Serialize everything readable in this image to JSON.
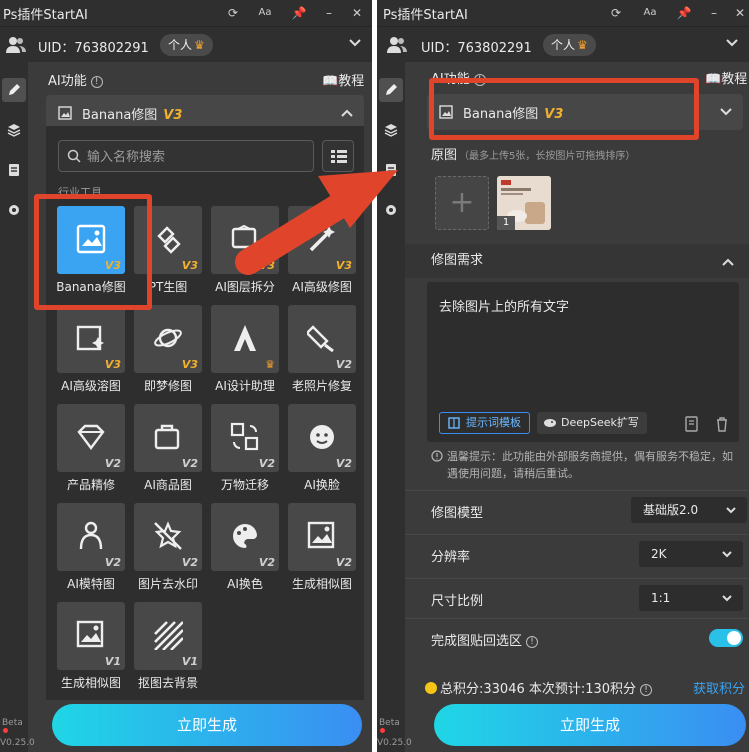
{
  "app_title": "Ps插件StartAI",
  "uid_label": "UID：763802291",
  "plan_badge": "个人",
  "sidebar_beta": "Beta",
  "sidebar_version": "V0.25.0",
  "ai_function_label": "AI功能",
  "tutorial_label": "教程",
  "feature": {
    "name": "Banana修图",
    "version": "V3"
  },
  "left": {
    "search_placeholder": "输入名称搜索",
    "category_label": "行业工具",
    "tools": [
      {
        "label": "Banana修图",
        "ver": "V3",
        "icon": "image-edit-icon"
      },
      {
        "label": "PT生图",
        "ver": "V3",
        "icon": "link-icon"
      },
      {
        "label": "AI图层拆分",
        "ver": "V3",
        "icon": "layer-split-icon"
      },
      {
        "label": "AI高级修图",
        "ver": "V3",
        "icon": "magic-wand-icon"
      },
      {
        "label": "AI高级溶图",
        "ver": "V3",
        "icon": "sparkle-image-icon"
      },
      {
        "label": "即梦修图",
        "ver": "V3",
        "icon": "planet-icon"
      },
      {
        "label": "AI设计助理",
        "ver": "crown",
        "icon": "designer-a-icon"
      },
      {
        "label": "老照片修复",
        "ver": "V2",
        "icon": "restore-icon"
      },
      {
        "label": "产品精修",
        "ver": "V2",
        "icon": "diamond-icon"
      },
      {
        "label": "AI商品图",
        "ver": "V2",
        "icon": "bag-icon"
      },
      {
        "label": "万物迁移",
        "ver": "V2",
        "icon": "transfer-icon"
      },
      {
        "label": "AI换脸",
        "ver": "V2",
        "icon": "face-icon"
      },
      {
        "label": "AI模特图",
        "ver": "V2",
        "icon": "model-icon"
      },
      {
        "label": "图片去水印",
        "ver": "V2",
        "icon": "no-watermark-icon"
      },
      {
        "label": "AI换色",
        "ver": "V2",
        "icon": "palette-icon"
      },
      {
        "label": "生成相似图",
        "ver": "V2",
        "icon": "similar-image-icon"
      },
      {
        "label": "生成相似图",
        "ver": "V1",
        "icon": "similar-image-icon"
      },
      {
        "label": "抠图去背景",
        "ver": "V1",
        "icon": "stripes-icon"
      }
    ],
    "generate_label": "立即生成"
  },
  "right": {
    "original_label": "原图",
    "upload_hint": "（最多上传5张，长按图片可拖拽排序）",
    "thumb_index": "1",
    "requirement_label": "修图需求",
    "requirement_text": "去除图片上的所有文字",
    "template_button": "提示词模板",
    "deepseek_button": "DeepSeek扩写",
    "notice": "温馨提示：此功能由外部服务商提供，偶有服务不稳定，如遇使用问题，请稍后重试。",
    "model_label": "修图模型",
    "model_value": "基础版2.0",
    "resolution_label": "分辨率",
    "resolution_value": "2K",
    "ratio_label": "尺寸比例",
    "ratio_value": "1:1",
    "paste_label": "完成图贴回选区",
    "paste_enabled": true,
    "credits_text": "总积分:33046  本次预计:130积分",
    "get_credits": "获取积分",
    "generate_label": "立即生成"
  },
  "colors": {
    "accent": "#3aa3f2",
    "highlight": "#e0452c",
    "version_gold": "#f0b030",
    "panel_bg": "#3b3b3b"
  }
}
